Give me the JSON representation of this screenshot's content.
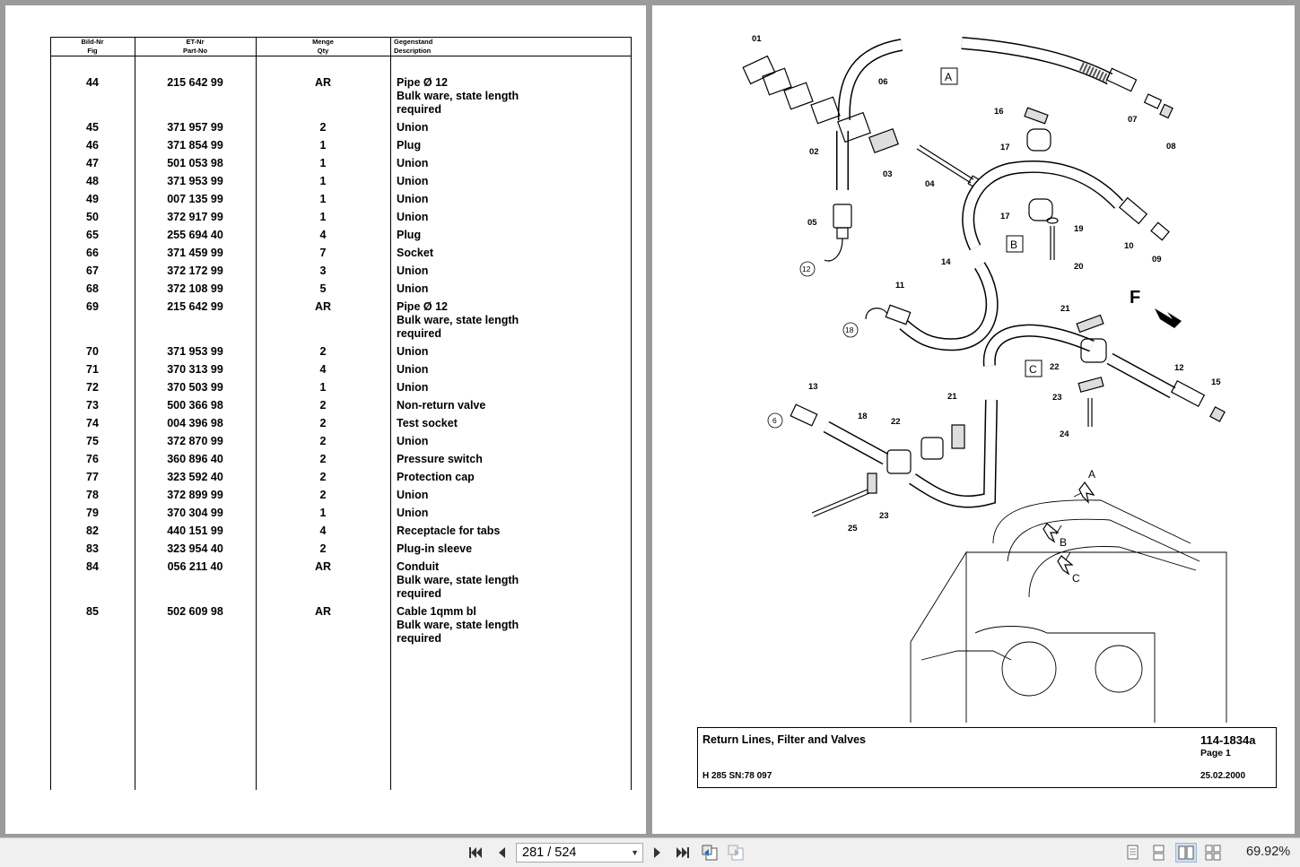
{
  "table": {
    "headers": [
      {
        "de": "Bild-Nr",
        "en": "Fig"
      },
      {
        "de": "ET-Nr",
        "en": "Part-No"
      },
      {
        "de": "Menge",
        "en": "Qty"
      },
      {
        "de": "Gegenstand",
        "en": "Description"
      }
    ],
    "rows": [
      {
        "fig": "44",
        "part": "215 642 99",
        "qty": "AR",
        "desc": [
          "Pipe Ø 12",
          "Bulk ware, state length",
          "required"
        ]
      },
      {
        "fig": "45",
        "part": "371 957 99",
        "qty": "2",
        "desc": [
          "Union"
        ]
      },
      {
        "fig": "46",
        "part": "371 854 99",
        "qty": "1",
        "desc": [
          "Plug"
        ]
      },
      {
        "fig": "47",
        "part": "501 053 98",
        "qty": "1",
        "desc": [
          "Union"
        ]
      },
      {
        "fig": "48",
        "part": "371 953 99",
        "qty": "1",
        "desc": [
          "Union"
        ]
      },
      {
        "fig": "49",
        "part": "007 135 99",
        "qty": "1",
        "desc": [
          "Union"
        ]
      },
      {
        "fig": "50",
        "part": "372 917 99",
        "qty": "1",
        "desc": [
          "Union"
        ]
      },
      {
        "fig": "65",
        "part": "255 694 40",
        "qty": "4",
        "desc": [
          "Plug"
        ]
      },
      {
        "fig": "66",
        "part": "371 459 99",
        "qty": "7",
        "desc": [
          "Socket"
        ]
      },
      {
        "fig": "67",
        "part": "372 172 99",
        "qty": "3",
        "desc": [
          "Union"
        ]
      },
      {
        "fig": "68",
        "part": "372 108 99",
        "qty": "5",
        "desc": [
          "Union"
        ]
      },
      {
        "fig": "69",
        "part": "215 642 99",
        "qty": "AR",
        "desc": [
          "Pipe Ø 12",
          "Bulk ware, state length",
          "required"
        ]
      },
      {
        "fig": "70",
        "part": "371 953 99",
        "qty": "2",
        "desc": [
          "Union"
        ]
      },
      {
        "fig": "71",
        "part": "370 313 99",
        "qty": "4",
        "desc": [
          "Union"
        ]
      },
      {
        "fig": "72",
        "part": "370 503 99",
        "qty": "1",
        "desc": [
          "Union"
        ]
      },
      {
        "fig": "73",
        "part": "500 366 98",
        "qty": "2",
        "desc": [
          "Non-return valve"
        ]
      },
      {
        "fig": "74",
        "part": "004 396 98",
        "qty": "2",
        "desc": [
          "Test socket"
        ]
      },
      {
        "fig": "75",
        "part": "372 870 99",
        "qty": "2",
        "desc": [
          "Union"
        ]
      },
      {
        "fig": "76",
        "part": "360 896 40",
        "qty": "2",
        "desc": [
          "Pressure switch"
        ]
      },
      {
        "fig": "77",
        "part": "323 592 40",
        "qty": "2",
        "desc": [
          "Protection cap"
        ]
      },
      {
        "fig": "78",
        "part": "372 899 99",
        "qty": "2",
        "desc": [
          "Union"
        ]
      },
      {
        "fig": "79",
        "part": "370 304 99",
        "qty": "1",
        "desc": [
          "Union"
        ]
      },
      {
        "fig": "82",
        "part": "440 151 99",
        "qty": "4",
        "desc": [
          "Receptacle for tabs"
        ]
      },
      {
        "fig": "83",
        "part": "323 954 40",
        "qty": "2",
        "desc": [
          "Plug-in sleeve"
        ]
      },
      {
        "fig": "84",
        "part": "056 211 40",
        "qty": "AR",
        "desc": [
          "Conduit",
          "Bulk ware, state length",
          "required"
        ]
      },
      {
        "fig": "85",
        "part": "502 609 98",
        "qty": "AR",
        "desc": [
          "Cable 1qmm bl",
          "Bulk ware, state length",
          "required"
        ]
      }
    ]
  },
  "drawing": {
    "callouts": [
      "01",
      "02",
      "03",
      "04",
      "05",
      "06",
      "07",
      "08",
      "09",
      "10",
      "11",
      "12",
      "13",
      "14",
      "15",
      "16",
      "17",
      "17",
      "18",
      "19",
      "20",
      "21",
      "21",
      "22",
      "22",
      "23",
      "23",
      "24",
      "25"
    ],
    "circled": [
      "12",
      "18",
      "6"
    ],
    "boxed": [
      "A",
      "B",
      "C"
    ],
    "detail_arrows": [
      "A",
      "B",
      "C"
    ],
    "direction": "F"
  },
  "titleblock": {
    "title": "Return Lines, Filter and Valves",
    "number": "114-1834a",
    "page": "Page 1",
    "serial": "H 285 SN:78 097",
    "date": "25.02.2000"
  },
  "toolbar": {
    "page_field": "281 / 524",
    "zoom": "69.92%"
  }
}
